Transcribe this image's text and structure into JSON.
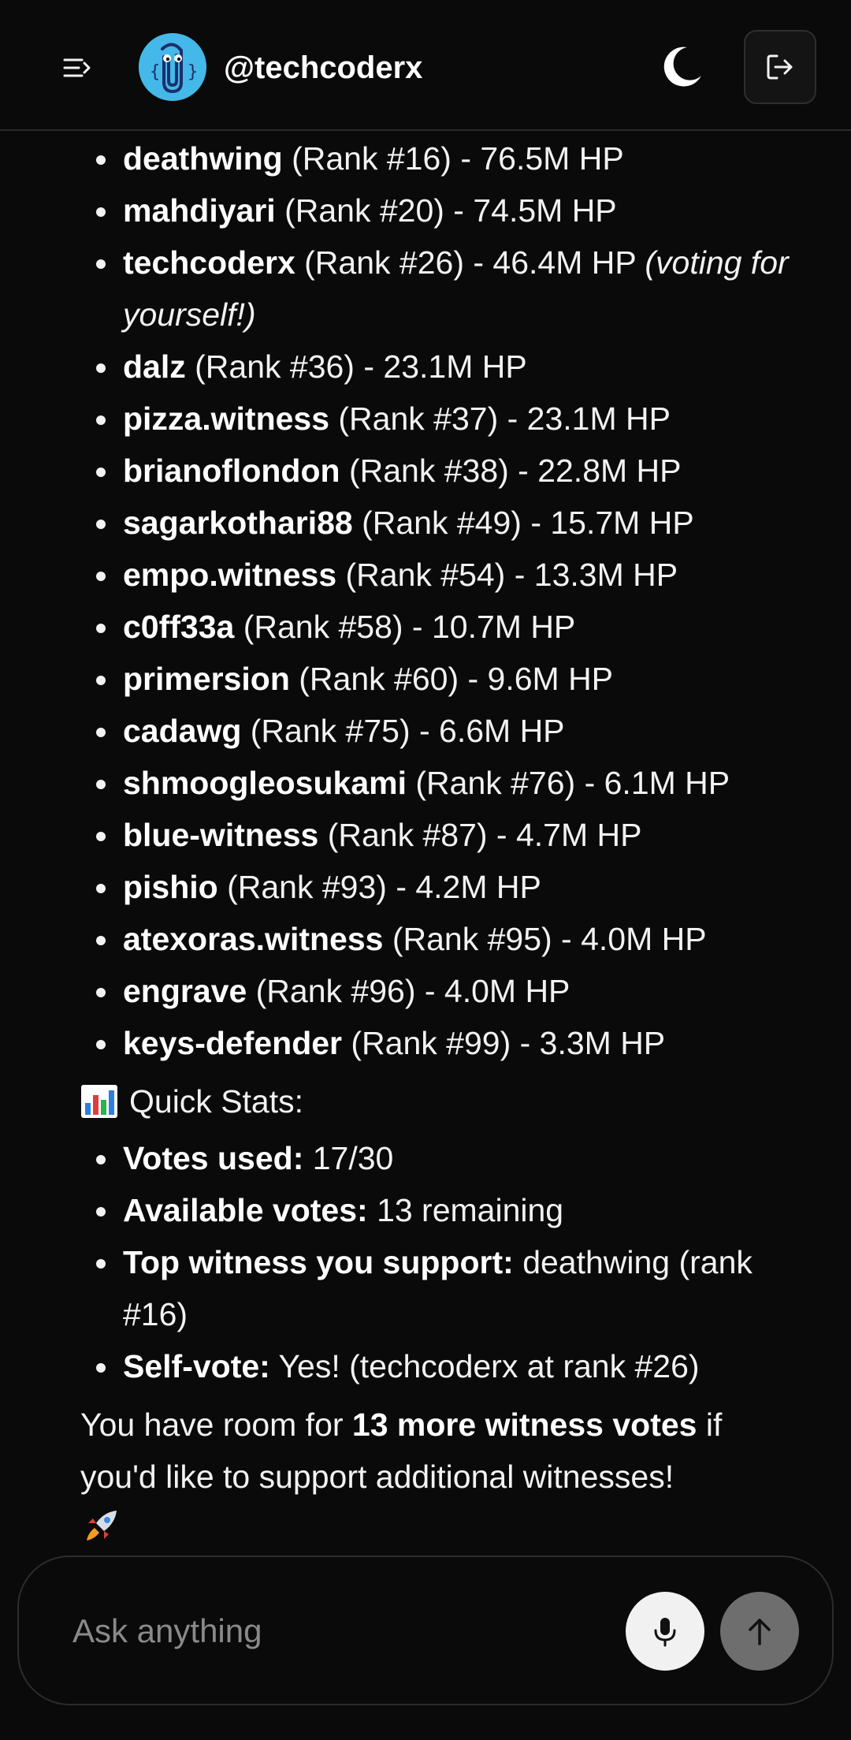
{
  "header": {
    "username": "@techcoderx",
    "icons": {
      "menu": "menu-expand-icon",
      "theme": "moon-icon",
      "logout": "logout-icon",
      "avatar": "clippy-avatar"
    }
  },
  "witness_list": [
    {
      "name": "deathwing",
      "detail": " (Rank #16) - 76.5M HP"
    },
    {
      "name": "mahdiyari",
      "detail": " (Rank #20) - 74.5M HP"
    },
    {
      "name": "techcoderx",
      "detail": " (Rank #26) - 46.4M HP ",
      "note": "(voting for yourself!)"
    },
    {
      "name": "dalz",
      "detail": " (Rank #36) - 23.1M HP"
    },
    {
      "name": "pizza.witness",
      "detail": " (Rank #37) - 23.1M HP"
    },
    {
      "name": "brianoflondon",
      "detail": " (Rank #38) - 22.8M HP"
    },
    {
      "name": "sagarkothari88",
      "detail": " (Rank #49) - 15.7M HP"
    },
    {
      "name": "empo.witness",
      "detail": " (Rank #54) - 13.3M HP"
    },
    {
      "name": "c0ff33a",
      "detail": " (Rank #58) - 10.7M HP"
    },
    {
      "name": "primersion",
      "detail": " (Rank #60) - 9.6M HP"
    },
    {
      "name": "cadawg",
      "detail": " (Rank #75) - 6.6M HP"
    },
    {
      "name": "shmoogleosukami",
      "detail": " (Rank #76) - 6.1M HP"
    },
    {
      "name": "blue-witness",
      "detail": " (Rank #87) - 4.7M HP"
    },
    {
      "name": "pishio",
      "detail": " (Rank #93) - 4.2M HP"
    },
    {
      "name": "atexoras.witness",
      "detail": " (Rank #95) - 4.0M HP"
    },
    {
      "name": "engrave",
      "detail": " (Rank #96) - 4.0M HP"
    },
    {
      "name": "keys-defender",
      "detail": " (Rank #99) - 3.3M HP"
    }
  ],
  "stats": {
    "heading": "Quick Stats:",
    "heading_icon": "bar-chart-emoji",
    "items": [
      {
        "label": "Votes used:",
        "value": " 17/30"
      },
      {
        "label": "Available votes:",
        "value": " 13 remaining"
      },
      {
        "label": "Top witness you support:",
        "value": " deathwing (rank #16)"
      },
      {
        "label": "Self-vote:",
        "value": " Yes! (techcoderx at rank #26)"
      }
    ]
  },
  "closing": {
    "before": "You have room for ",
    "bold": "13 more witness votes",
    "after": " if you'd like to support additional witnesses!",
    "emoji": "rocket-emoji"
  },
  "composer": {
    "placeholder": "Ask anything",
    "icons": {
      "mic": "microphone-icon",
      "send": "arrow-up-icon"
    }
  }
}
